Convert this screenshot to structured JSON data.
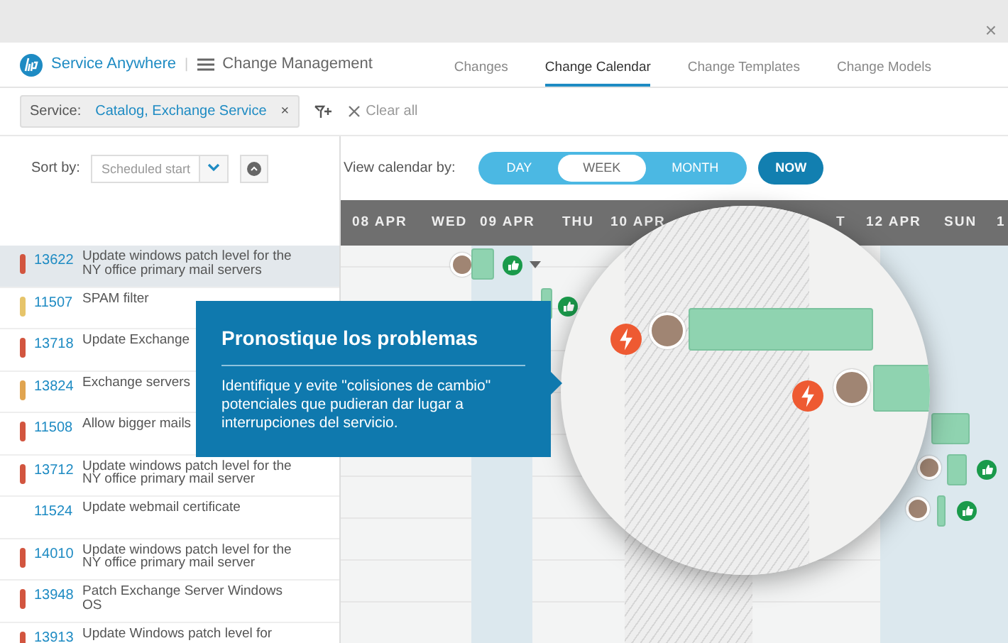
{
  "window": {
    "close": "×"
  },
  "app": {
    "brand": "Service Anywhere",
    "separator": "|",
    "module": "Change Management"
  },
  "tabs": [
    {
      "label": "Changes",
      "selected": false
    },
    {
      "label": "Change Calendar",
      "selected": true
    },
    {
      "label": "Change Templates",
      "selected": false
    },
    {
      "label": "Change Models",
      "selected": false
    }
  ],
  "filter": {
    "label": "Service:",
    "value": "Catalog, Exchange Service",
    "remove": "×",
    "clear": "Clear all"
  },
  "sort": {
    "label": "Sort by:",
    "value": "Scheduled start"
  },
  "view": {
    "label": "View calendar by:",
    "options": [
      {
        "label": "DAY",
        "selected": false
      },
      {
        "label": "WEEK",
        "selected": true
      },
      {
        "label": "MONTH",
        "selected": false
      }
    ],
    "now": "NOW"
  },
  "calendar_header": [
    "08 APR",
    "WED",
    "09 APR",
    "THU",
    "10 APR",
    "T",
    "12 APR",
    "SUN",
    "1"
  ],
  "changes": [
    {
      "id": "13622",
      "title": "Update windows patch level for the NY office primary mail servers",
      "color": "#d2553f",
      "selected": true
    },
    {
      "id": "11507",
      "title": "SPAM filter",
      "color": "#e6c46a",
      "selected": false
    },
    {
      "id": "13718",
      "title": "Update Exchange",
      "color": "#d2553f",
      "selected": false
    },
    {
      "id": "13824",
      "title": "Exchange servers",
      "color": "#e0a450",
      "selected": false
    },
    {
      "id": "11508",
      "title": "Allow bigger mails",
      "color": "#d2553f",
      "selected": false
    },
    {
      "id": "13712",
      "title": "Update windows patch level for the NY office primary mail server",
      "color": "#d2553f",
      "selected": false
    },
    {
      "id": "11524",
      "title": "Update webmail certificate",
      "selected": false
    },
    {
      "id": "14010",
      "title": "Update windows patch level for the NY office primary mail server",
      "color": "#d2553f",
      "selected": false
    },
    {
      "id": "13948",
      "title": "Patch Exchange Server Windows OS",
      "color": "#d2553f",
      "selected": false
    },
    {
      "id": "13913",
      "title": "Update Windows patch level for",
      "color": "#d2553f",
      "selected": false
    }
  ],
  "events": [
    {
      "kind": "approved"
    },
    {
      "kind": "approved"
    },
    {
      "kind": "conflict"
    },
    {
      "kind": "conflict"
    },
    {
      "kind": "plain"
    },
    {
      "kind": "approved"
    },
    {
      "kind": "approved"
    }
  ],
  "callout": {
    "title": "Pronostique los problemas",
    "text": "Identifique y evite \"colisiones de cambio\" potenciales que pudieran dar lugar a interrupciones del servicio."
  }
}
